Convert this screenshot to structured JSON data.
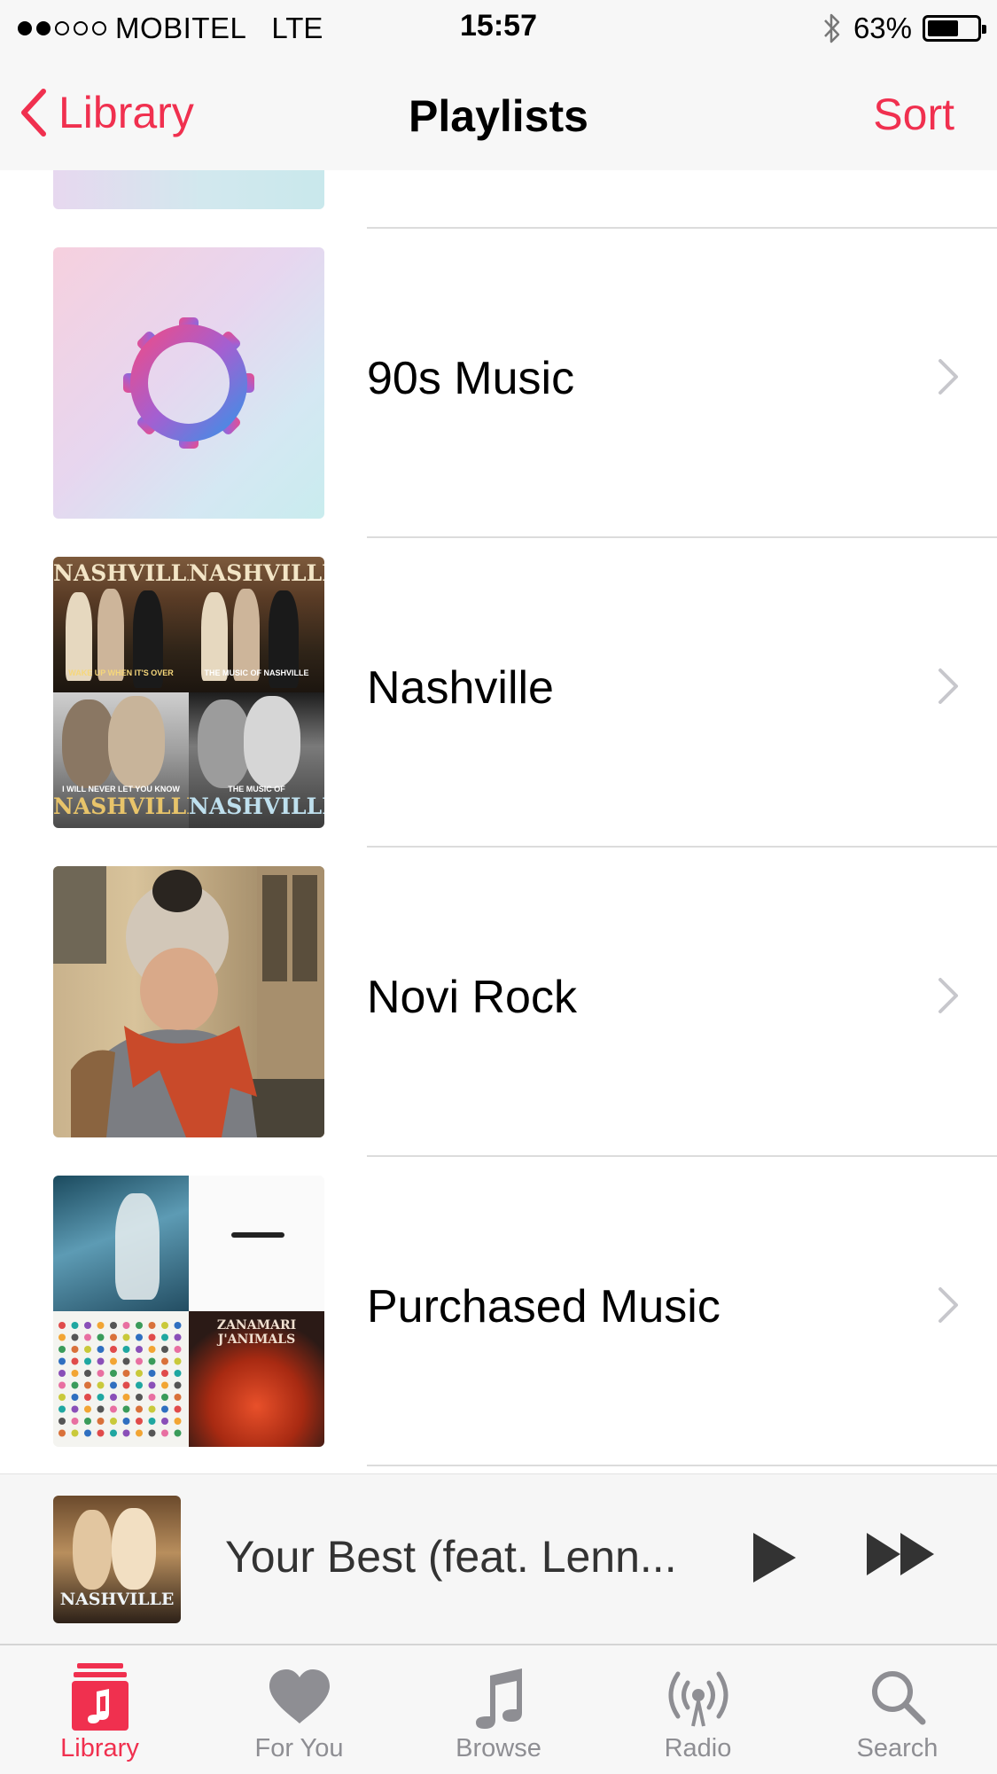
{
  "status_bar": {
    "carrier": "MOBITEL",
    "network": "LTE",
    "time": "15:57",
    "battery_percent": "63%",
    "battery_level": 0.63,
    "signal_bars": 2
  },
  "nav": {
    "back_label": "Library",
    "title": "Playlists",
    "sort_label": "Sort"
  },
  "playlists": [
    {
      "title": "90s Music",
      "art": "gear-icon"
    },
    {
      "title": "Nashville",
      "art": "album-grid"
    },
    {
      "title": "Novi Rock",
      "art": "photo"
    },
    {
      "title": "Purchased Music",
      "art": "album-grid"
    }
  ],
  "art_text": {
    "nashville": "NASHVILLE",
    "nash_tl_sub": "WAKE UP WHEN IT'S OVER",
    "nash_tr_sub": "THE MUSIC OF NASHVILLE",
    "nash_bl_sub": "I WILL NEVER LET YOU KNOW",
    "nash_br_sub": "THE MUSIC OF",
    "zanamari": "ZANAMARI J'ANIMALS"
  },
  "mini_player": {
    "track_title": "Your Best (feat. Lenn...",
    "play_icon": "play-icon",
    "next_icon": "fast-forward-icon"
  },
  "tabs": [
    {
      "label": "Library",
      "icon": "library-icon",
      "active": true
    },
    {
      "label": "For You",
      "icon": "heart-icon",
      "active": false
    },
    {
      "label": "Browse",
      "icon": "music-note-icon",
      "active": false
    },
    {
      "label": "Radio",
      "icon": "radio-icon",
      "active": false
    },
    {
      "label": "Search",
      "icon": "search-icon",
      "active": false
    }
  ],
  "colors": {
    "accent": "#f0304f",
    "tab_inactive": "#8e8e93",
    "separator": "#dcdcdc"
  }
}
